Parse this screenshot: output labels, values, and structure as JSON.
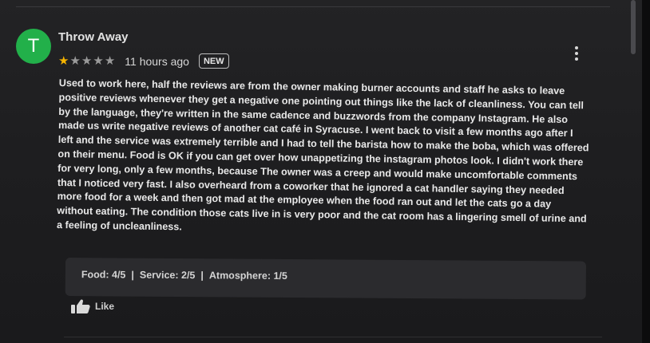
{
  "review": {
    "avatar_letter": "T",
    "avatar_color": "#22b04a",
    "author": "Throw Away",
    "rating": 1,
    "rating_max": 5,
    "star_color": "#f6b400",
    "time_ago": "11 hours ago",
    "badge": "NEW",
    "body": "Used to work here, half the reviews are from the owner making burner accounts and staff he asks to leave positive reviews whenever they get a negative one pointing out things like the lack of cleanliness. You can tell by the language, they're written in the same cadence and buzzwords from the company Instagram. He also made us write negative reviews of another cat café in Syracuse. I went back to visit a few months ago after I left and the service was extremely terrible and I had to tell the barista how to make the boba, which was offered on their menu. Food is OK if you can get over how unappetizing the instagram photos look. I didn't work there for very long, only a few months, because The owner was a creep and would make uncomfortable comments that I noticed very fast. I also overheard from a coworker that he ignored a cat handler saying they needed more food for a week and then got mad at the employee when the food ran out and let the cats go a day without eating. The condition those cats live in is very poor and the cat room has a lingering smell of urine and a feeling of uncleanliness.",
    "attributes": {
      "food": "Food: 4/5",
      "service": "Service: 2/5",
      "atmosphere": "Atmosphere: 1/5",
      "separator": "|"
    },
    "like_label": "Like",
    "more_icon": "more-vert-icon",
    "like_icon": "thumbs-up-icon"
  }
}
